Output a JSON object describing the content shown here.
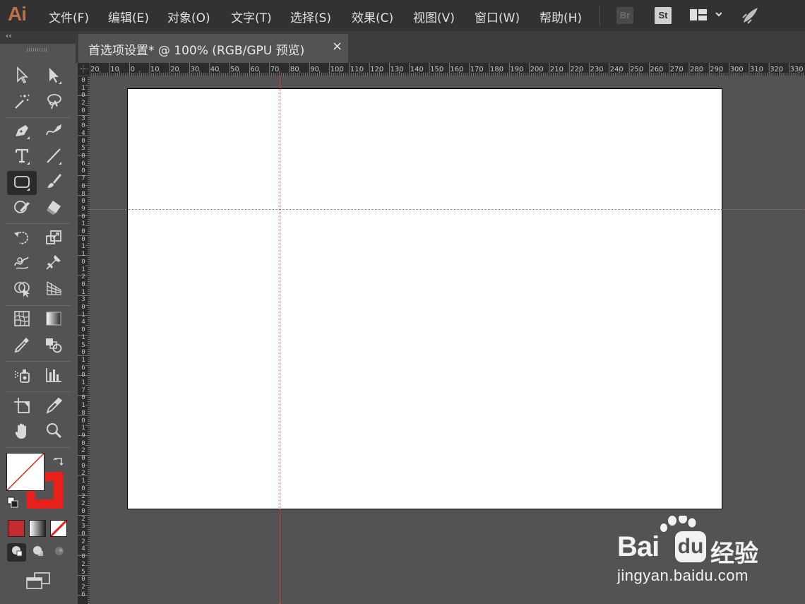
{
  "app": {
    "logo": "Ai"
  },
  "menu": [
    "文件(F)",
    "编辑(E)",
    "对象(O)",
    "文字(T)",
    "选择(S)",
    "效果(C)",
    "视图(V)",
    "窗口(W)",
    "帮助(H)"
  ],
  "bridge_buttons": {
    "br": "Br",
    "st": "St"
  },
  "toolbar": {
    "collapse": "‹‹"
  },
  "document_tab": {
    "title": "首选项设置* @ 100% (RGB/GPU 预览)",
    "close": "×"
  },
  "ruler": {
    "h_labels": [
      "20",
      "10",
      "0",
      "10",
      "20",
      "30",
      "40",
      "50",
      "60",
      "70",
      "80",
      "90",
      "100",
      "110",
      "120",
      "130",
      "140",
      "150",
      "160",
      "170",
      "180",
      "190",
      "200",
      "210",
      "220",
      "230",
      "240",
      "250",
      "260",
      "270",
      "280",
      "290",
      "300",
      "310",
      "320",
      "330"
    ],
    "v_labels": [
      "0",
      "1",
      "0",
      "2",
      "0",
      "3",
      "0",
      "4",
      "0",
      "5",
      "0",
      "6",
      "0",
      "7",
      "0",
      "8",
      "0",
      "9",
      "0",
      "1",
      "0",
      "0",
      "1",
      "1",
      "0",
      "1",
      "2",
      "0",
      "1",
      "3",
      "0",
      "1",
      "4",
      "0",
      "1",
      "5",
      "0",
      "1",
      "6",
      "0",
      "1",
      "7",
      "0",
      "1",
      "8",
      "0",
      "1",
      "9",
      "0",
      "2",
      "0",
      "0",
      "2",
      "1",
      "0",
      "2",
      "2",
      "0",
      "2",
      "3",
      "0",
      "2",
      "4",
      "0",
      "2",
      "5",
      "0",
      "2",
      "6"
    ]
  },
  "colors": {
    "menubar": "#323232",
    "panel": "#535353",
    "artboard": "#ffffff",
    "guide": "#d0605a",
    "stroke": "#e8201c",
    "fill_none": "#ffffff",
    "accent_logo": "#b9734a"
  },
  "watermark": {
    "brand": "Bai",
    "brand2": "du",
    "suffix": "经验",
    "url": "jingyan.baidu.com"
  },
  "icons": [
    "selection-tool-icon",
    "direct-selection-tool-icon",
    "magic-wand-tool-icon",
    "lasso-tool-icon",
    "pen-tool-icon",
    "curvature-tool-icon",
    "type-tool-icon",
    "line-segment-tool-icon",
    "rounded-rectangle-tool-icon",
    "paintbrush-tool-icon",
    "shaper-tool-icon",
    "eraser-tool-icon",
    "rotate-tool-icon",
    "scale-tool-icon",
    "warp-tool-icon",
    "puppet-warp-tool-icon",
    "shape-builder-tool-icon",
    "perspective-grid-tool-icon",
    "mesh-tool-icon",
    "gradient-tool-icon",
    "eyedropper-tool-icon",
    "blend-tool-icon",
    "symbol-sprayer-tool-icon",
    "column-graph-tool-icon",
    "artboard-tool-icon",
    "slice-tool-icon",
    "hand-tool-icon",
    "zoom-tool-icon"
  ]
}
